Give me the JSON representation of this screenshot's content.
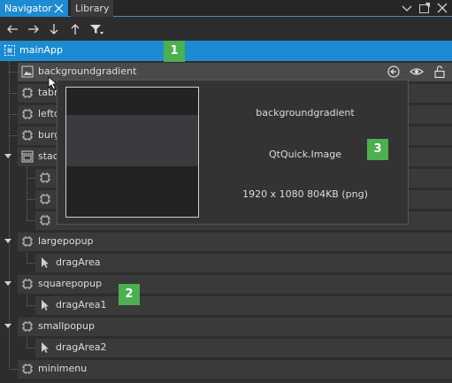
{
  "tabs": {
    "navigator": "Navigator",
    "library": "Library"
  },
  "toolbar": {
    "icons": [
      "arrow-left-icon",
      "arrow-right-icon",
      "arrow-down-icon",
      "arrow-up-icon",
      "filter-icon"
    ]
  },
  "tree": {
    "root": "mainApp",
    "items": [
      {
        "label": "backgroundgradient",
        "icon": "image-icon"
      },
      {
        "label": "tabm",
        "icon": "component-icon"
      },
      {
        "label": "leftd",
        "icon": "component-icon"
      },
      {
        "label": "burg",
        "icon": "component-icon"
      },
      {
        "label": "stack",
        "icon": "stack-icon"
      },
      {
        "label": "",
        "icon": "component-icon"
      },
      {
        "label": "",
        "icon": "component-icon"
      },
      {
        "label": "",
        "icon": "component-icon"
      },
      {
        "label": "largepopup",
        "icon": "component-icon"
      },
      {
        "label": "dragArea",
        "icon": "cursor-icon"
      },
      {
        "label": "squarepopup",
        "icon": "component-icon"
      },
      {
        "label": "dragArea1",
        "icon": "cursor-icon"
      },
      {
        "label": "smallpopup",
        "icon": "component-icon"
      },
      {
        "label": "dragArea2",
        "icon": "cursor-icon"
      },
      {
        "label": "minimenu",
        "icon": "component-icon"
      }
    ]
  },
  "preview": {
    "name": "backgroundgradient",
    "type": "QtQuick.Image",
    "info": "1920 x 1080 804KB (png)"
  },
  "badges": {
    "b1": "1",
    "b2": "2",
    "b3": "3"
  },
  "colors": {
    "accent": "#1d8bd1",
    "badge": "#4caf50",
    "background": "#2d2d2d",
    "row": "#3a3a3a"
  }
}
